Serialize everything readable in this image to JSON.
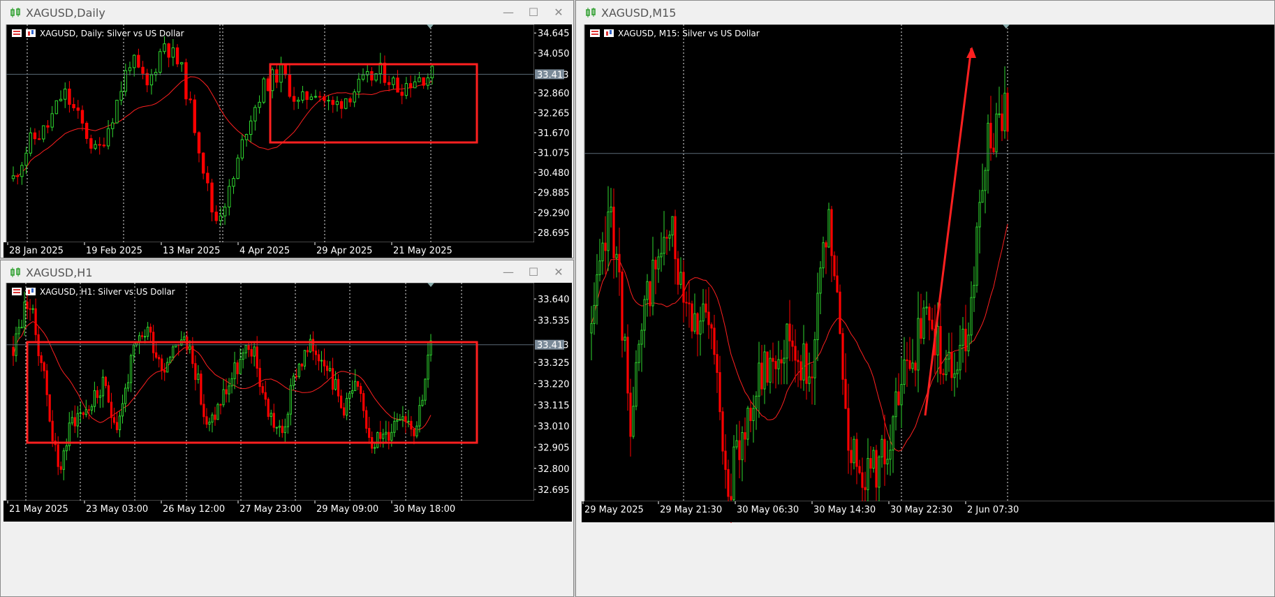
{
  "colors": {
    "bull": "#2fd82f",
    "bear": "#ff0000",
    "ma": "#ff2020",
    "grid": "#e8e8e8",
    "price_line": "#5c6b78",
    "annotation": "#ff2020"
  },
  "windows": {
    "daily": {
      "title": "XAGUSD,Daily",
      "header": "XAGUSD, Daily:  Silver vs US Dollar",
      "price_label": "33.413",
      "yticks": [
        "34.645",
        "34.050",
        "33.413",
        "32.860",
        "32.265",
        "31.670",
        "31.075",
        "30.480",
        "29.885",
        "29.290",
        "28.695"
      ],
      "xticks": [
        "28 Jan 2025",
        "19 Feb 2025",
        "13 Mar 2025",
        "4 Apr 2025",
        "29 Apr 2025",
        "21 May 2025"
      ]
    },
    "h1": {
      "title": "XAGUSD,H1",
      "header": "XAGUSD, H1:  Silver vs US Dollar",
      "price_label": "33.413",
      "yticks": [
        "33.640",
        "33.535",
        "33.413",
        "33.325",
        "33.220",
        "33.115",
        "33.010",
        "32.905",
        "32.800",
        "32.695"
      ],
      "xticks": [
        "21 May 2025",
        "23 May 03:00",
        "26 May 12:00",
        "27 May 23:00",
        "29 May 09:00",
        "30 May 18:00"
      ]
    },
    "m15": {
      "title": "XAGUSD,M15",
      "header": "XAGUSD, M15:  Silver vs US Dollar",
      "xticks": [
        "29 May 2025",
        "29 May 21:30",
        "30 May 06:30",
        "30 May 14:30",
        "30 May 22:30",
        "2 Jun 07:30"
      ]
    }
  },
  "chart_data": [
    {
      "type": "candlestick",
      "symbol": "XAGUSD",
      "timeframe": "Daily",
      "last_price": 33.413,
      "ylim": [
        28.4,
        34.9
      ],
      "x": [
        "28 Jan 2025",
        "19 Feb 2025",
        "13 Mar 2025",
        "4 Apr 2025",
        "29 Apr 2025",
        "21 May 2025"
      ],
      "close_path": [
        30.3,
        31.4,
        31.8,
        32.9,
        32.0,
        31.0,
        32.3,
        33.9,
        33.0,
        34.4,
        33.6,
        31.5,
        29.0,
        30.0,
        32.0,
        33.1,
        33.5,
        32.5,
        33.0,
        32.4,
        32.8,
        33.2,
        33.5,
        33.0,
        33.3,
        33.413
      ]
    },
    {
      "type": "candlestick",
      "symbol": "XAGUSD",
      "timeframe": "H1",
      "last_price": 33.413,
      "ylim": [
        32.64,
        33.72
      ],
      "x": [
        "21 May 2025",
        "23 May 03:00",
        "26 May 12:00",
        "27 May 23:00",
        "29 May 09:00",
        "30 May 18:00"
      ],
      "close_path": [
        33.4,
        33.65,
        33.3,
        32.78,
        33.05,
        33.1,
        33.2,
        33.02,
        33.35,
        33.5,
        33.3,
        33.45,
        33.38,
        32.98,
        33.15,
        33.3,
        33.4,
        33.1,
        32.95,
        33.3,
        33.4,
        33.35,
        33.1,
        33.2,
        32.95,
        32.95,
        33.1,
        33.0,
        33.413
      ]
    },
    {
      "type": "candlestick",
      "symbol": "XAGUSD",
      "timeframe": "M15",
      "ylim": [
        32.5,
        34.2
      ],
      "x": [
        "29 May 2025",
        "29 May 21:30",
        "30 May 06:30",
        "30 May 14:30",
        "30 May 22:30",
        "2 Jun 07:30"
      ],
      "close_path": [
        33.1,
        33.55,
        32.8,
        33.3,
        33.45,
        33.2,
        33.1,
        32.55,
        32.85,
        33.0,
        33.1,
        32.95,
        33.5,
        32.7,
        32.6,
        32.7,
        33.0,
        33.15,
        32.95,
        33.1,
        33.8,
        33.9
      ]
    }
  ]
}
